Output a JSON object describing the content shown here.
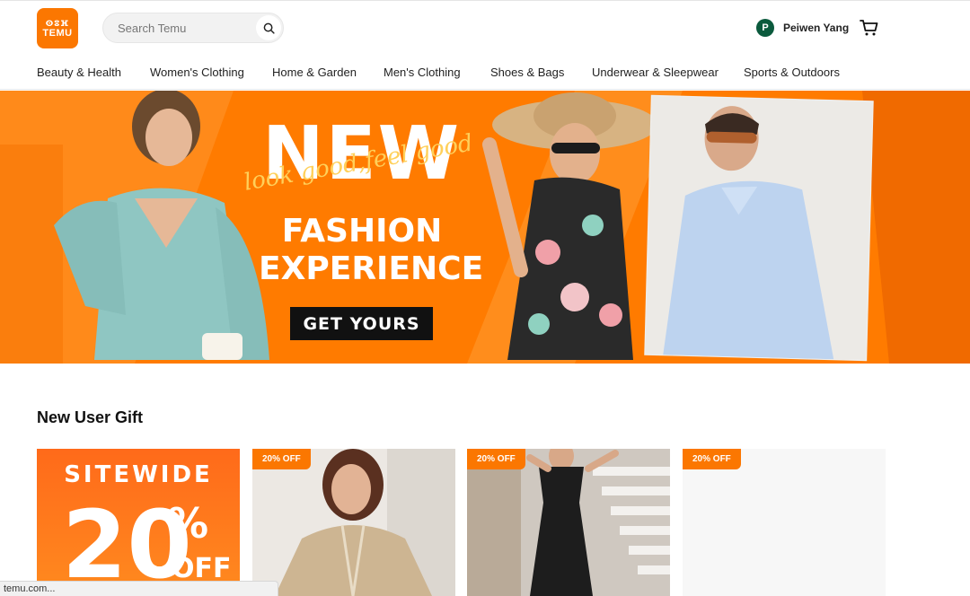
{
  "header": {
    "logo_top": "ⵙⵓⴼ",
    "logo_text": "TEMU",
    "search_placeholder": "Search Temu",
    "user_initial": "P",
    "user_name": "Peiwen Yang"
  },
  "nav": {
    "items": [
      {
        "label": "Beauty & Health"
      },
      {
        "label": "Women's Clothing"
      },
      {
        "label": "Home & Garden"
      },
      {
        "label": "Men's Clothing"
      },
      {
        "label": "Shoes & Bags"
      },
      {
        "label": "Underwear & Sleepwear"
      },
      {
        "label": "Sports & Outdoors"
      }
    ]
  },
  "hero": {
    "headline": "NEW",
    "script": "look good,feel good",
    "line1": "FASHION",
    "line2": "EXPERIENCE",
    "cta": "GET YOURS"
  },
  "section": {
    "title": "New User Gift",
    "sitewide": {
      "word": "SITEWIDE",
      "number": "20",
      "percent": "%",
      "off": "OFF"
    },
    "products": [
      {
        "badge": "20% OFF"
      },
      {
        "badge": "20% OFF"
      },
      {
        "badge": "20% OFF"
      }
    ]
  },
  "status_bar": "temu.com...",
  "colors": {
    "brand": "#fb7701",
    "avatar": "#0b5a3d"
  },
  "icons": [
    "search-icon",
    "cart-icon"
  ]
}
